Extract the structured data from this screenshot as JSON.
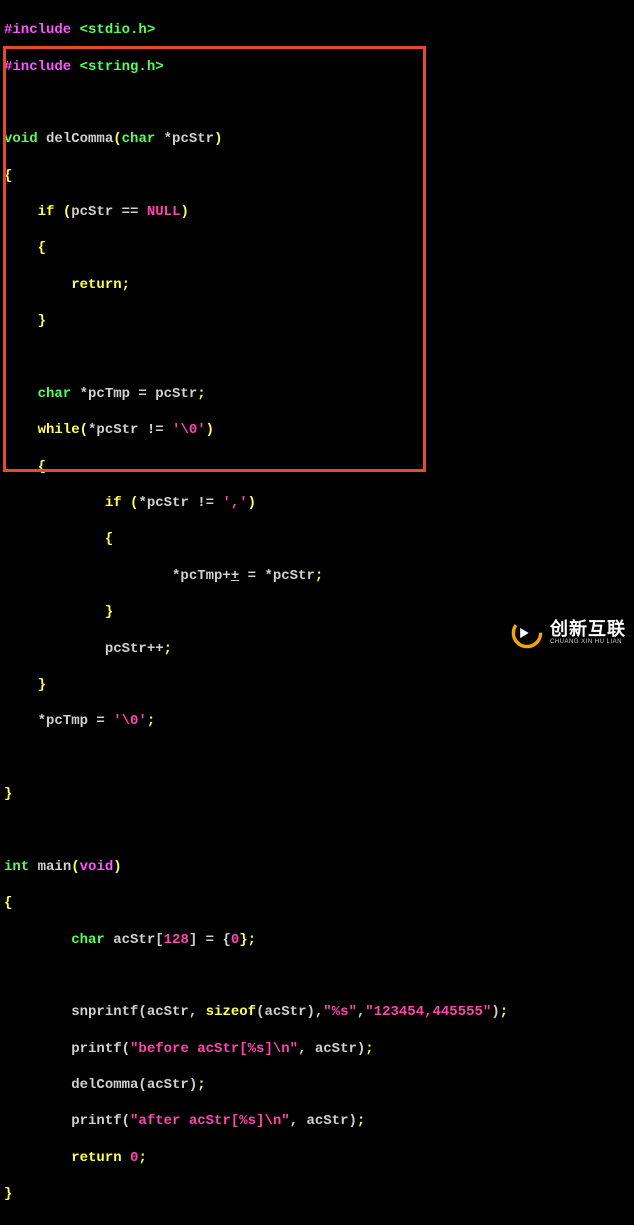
{
  "code": {
    "inc1_a": "#include",
    "inc1_b": " <stdio.h>",
    "inc2_a": "#include",
    "inc2_b": " <string.h>",
    "l03_a": "void",
    "l03_b": " delComma",
    "l03_c": "(",
    "l03_d": "char",
    "l03_e": " *pcStr",
    "l03_f": ")",
    "l04": "{",
    "l05_a": "    if",
    "l05_b": " ",
    "l05_c": "(",
    "l05_d": "pcStr == ",
    "l05_e": "NULL",
    "l05_f": ")",
    "l06_a": "    ",
    "l06_b": "{",
    "l07_a": "        return",
    "l07_b": ";",
    "l08_a": "    ",
    "l08_b": "}",
    "l09_a": "    char",
    "l09_b": " *pcTmp = pcStr",
    "l09_c": ";",
    "l10_a": "    while",
    "l10_b": "(",
    "l10_c": "*pcStr != ",
    "l10_d": "'\\0'",
    "l10_e": ")",
    "l11_a": "    ",
    "l11_b": "{",
    "l12_a": "            if",
    "l12_b": " ",
    "l12_c": "(",
    "l12_d": "*pcStr != ",
    "l12_e": "','",
    "l12_f": ")",
    "l13_a": "            ",
    "l13_b": "{",
    "l14_a": "                    *pcTmp+",
    "l14_b": "+",
    "l14_c": " = *pcStr",
    "l14_d": ";",
    "l15_a": "            ",
    "l15_b": "}",
    "l16_a": "            pcStr++",
    "l16_b": ";",
    "l17_a": "    ",
    "l17_b": "}",
    "l18_a": "    *pcTmp = ",
    "l18_b": "'\\0'",
    "l18_c": ";",
    "l19": "}",
    "l20_a": "int",
    "l20_b": " main",
    "l20_c": "(",
    "l20_d": "void",
    "l20_e": ")",
    "l21": "{",
    "l22_a": "        char",
    "l22_b": " acStr[",
    "l22_c": "128",
    "l22_d": "] = {",
    "l22_e": "0",
    "l22_f": "};",
    "l23_a": "        snprintf(acStr, ",
    "l23_b": "sizeof",
    "l23_c": "(acStr),",
    "l23_d": "\"%s\"",
    "l23_e": ",",
    "l23_f": "\"123454,445555\"",
    "l23_g": ")",
    "l23_h": ";",
    "l24_a": "        printf(",
    "l24_b": "\"before acStr[%s]\\n\"",
    "l24_c": ", acStr)",
    "l24_d": ";",
    "l25_a": "        delComma(acStr)",
    "l25_b": ";",
    "l26_a": "        printf(",
    "l26_b": "\"after acStr[%s]\\n\"",
    "l26_c": ", acStr)",
    "l26_d": ";",
    "l27_a": "        return",
    "l27_b": " ",
    "l27_c": "0",
    "l27_d": ";",
    "l28": "}"
  },
  "watermark": {
    "cn": "创新互联",
    "en": "CHUANG XIN HU LIAN"
  }
}
